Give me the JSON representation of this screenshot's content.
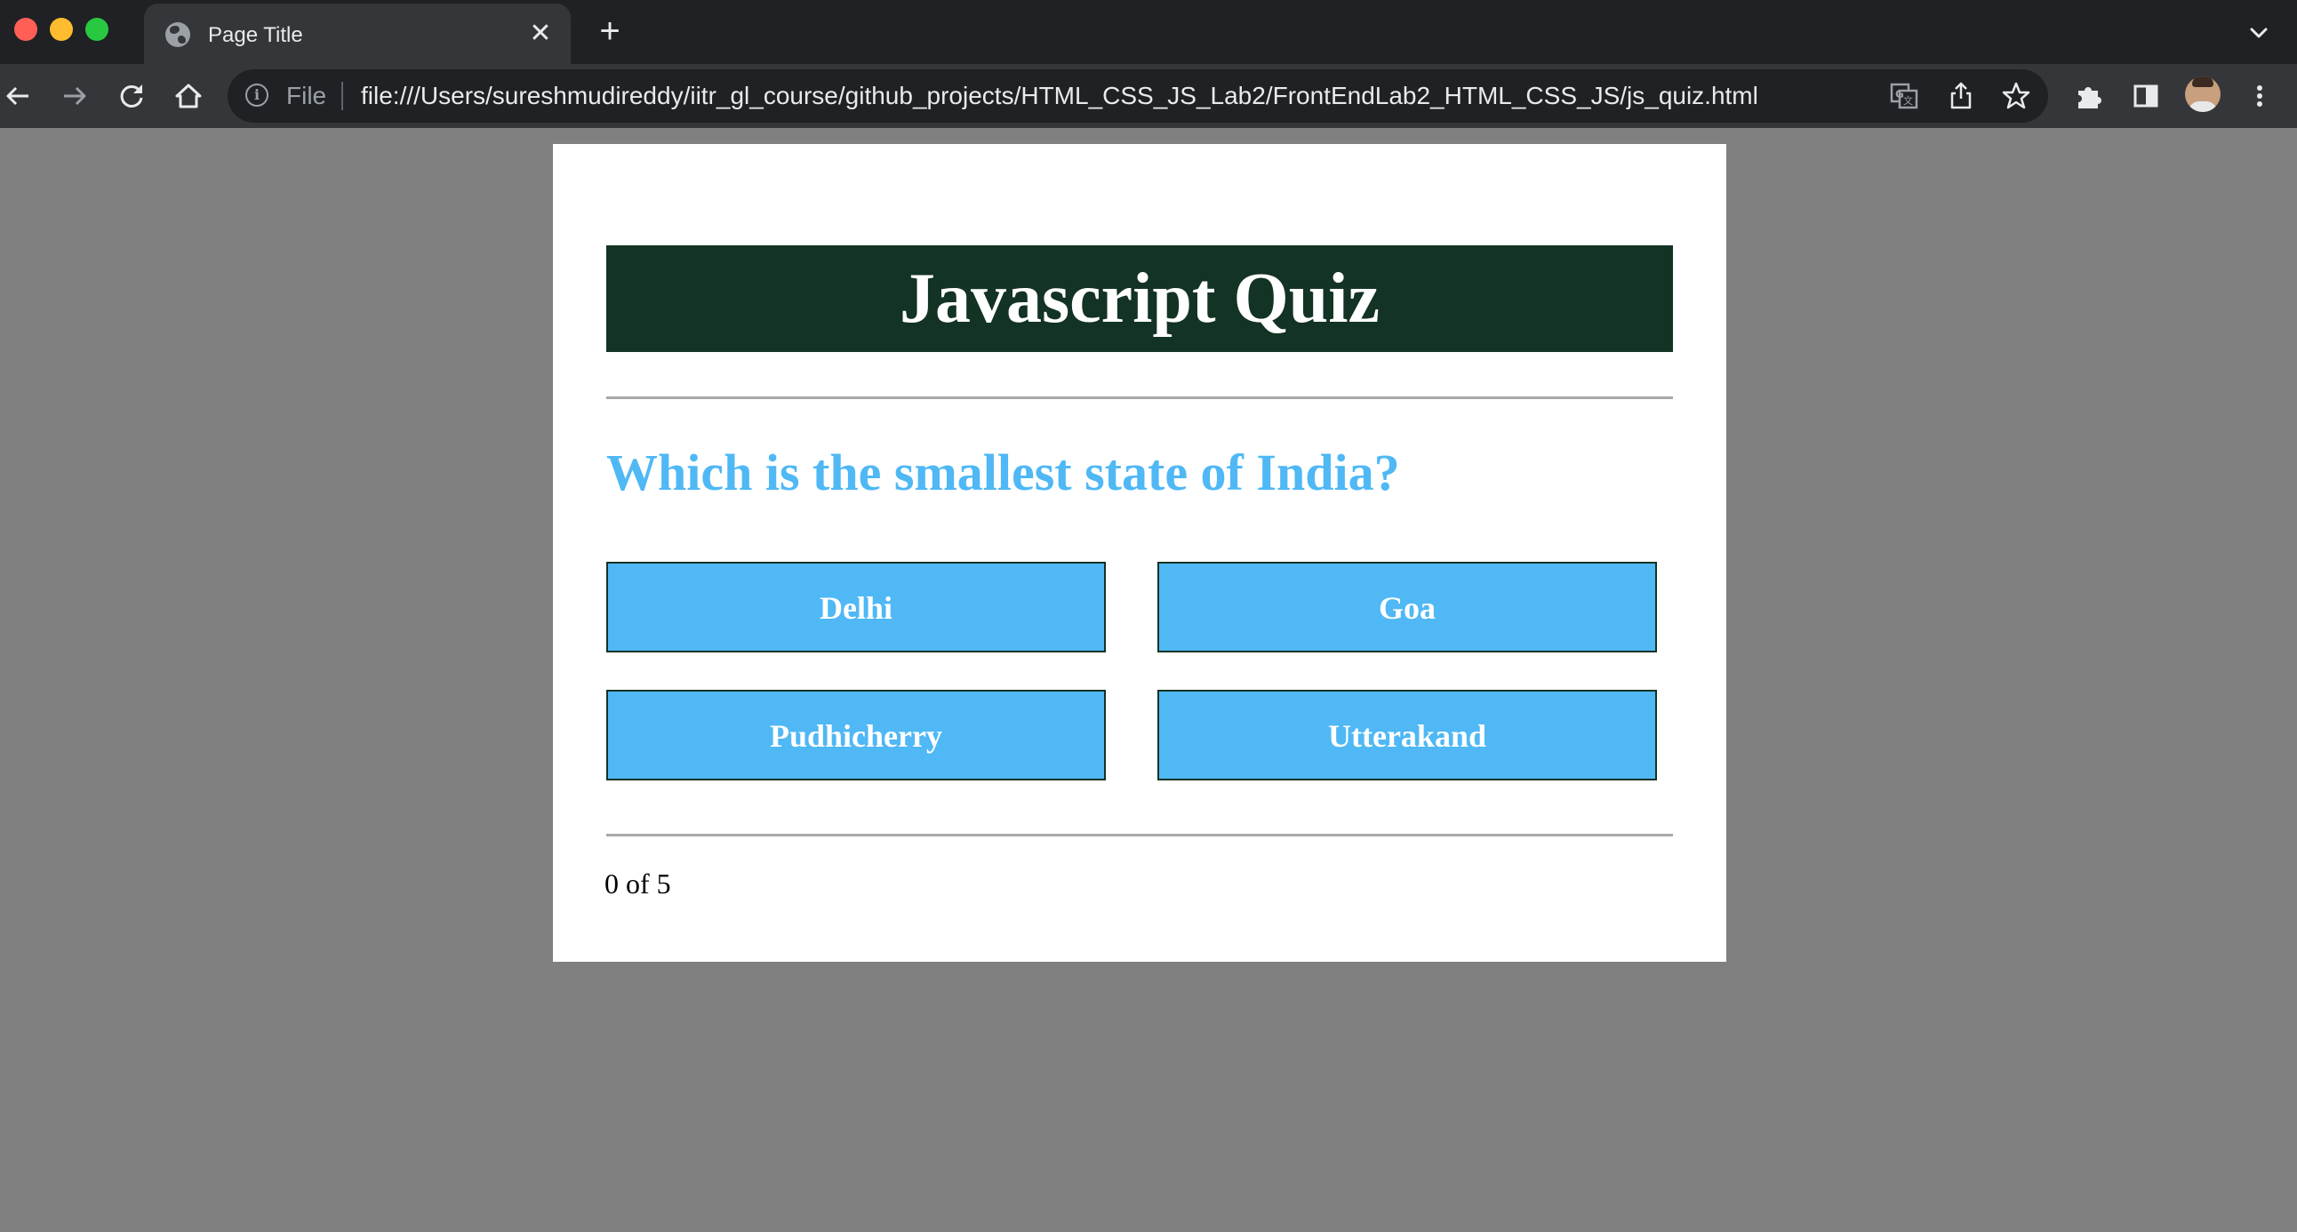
{
  "browser": {
    "tab": {
      "title": "Page Title"
    },
    "omnibox": {
      "scheme_label": "File",
      "url": "file:///Users/sureshmudireddy/iitr_gl_course/github_projects/HTML_CSS_JS_Lab2/FrontEndLab2_HTML_CSS_JS/js_quiz.html"
    },
    "icons": {
      "back": "back-arrow-icon",
      "forward": "forward-arrow-icon",
      "reload": "reload-icon",
      "home": "home-icon",
      "info": "info-icon",
      "translate": "translate-icon",
      "share": "share-icon",
      "bookmark": "star-icon",
      "extensions": "puzzle-icon",
      "side_panel": "side-panel-icon",
      "menu": "kebab-menu-icon"
    }
  },
  "quiz": {
    "title": "Javascript Quiz",
    "question": "Which is the smallest state of India?",
    "options": [
      "Delhi",
      "Goa",
      "Pudhicherry",
      "Utterakand"
    ],
    "progress": "0 of 5"
  },
  "colors": {
    "page_background": "#808080",
    "header_background": "#133324",
    "accent_blue": "#4fb8f5",
    "card_background": "#ffffff"
  }
}
